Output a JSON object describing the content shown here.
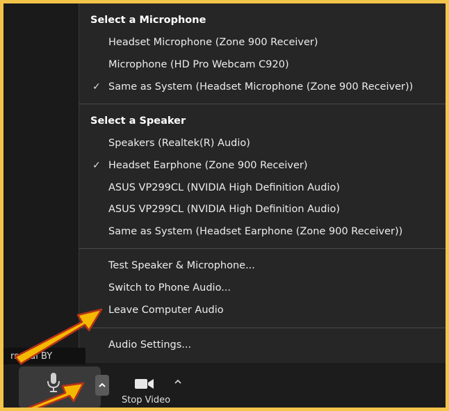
{
  "menu": {
    "microphone_section": {
      "title": "Select a Microphone",
      "items": [
        {
          "label": "Headset Microphone (Zone 900 Receiver)",
          "checked": false
        },
        {
          "label": "Microphone (HD Pro Webcam C920)",
          "checked": false
        },
        {
          "label": "Same as System (Headset Microphone (Zone 900 Receiver))",
          "checked": true
        }
      ]
    },
    "speaker_section": {
      "title": "Select a Speaker",
      "items": [
        {
          "label": "Speakers (Realtek(R) Audio)",
          "checked": false
        },
        {
          "label": "Headset Earphone (Zone 900 Receiver)",
          "checked": true
        },
        {
          "label": "ASUS VP299CL (NVIDIA High Definition Audio)",
          "checked": false
        },
        {
          "label": "ASUS VP299CL (NVIDIA High Definition Audio)",
          "checked": false
        },
        {
          "label": "Same as System (Headset Earphone (Zone 900 Receiver))",
          "checked": false
        }
      ]
    },
    "actions": [
      {
        "label": "Test Speaker & Microphone..."
      },
      {
        "label": "Switch to Phone Audio..."
      },
      {
        "label": "Leave Computer Audio"
      }
    ],
    "settings_label": "Audio Settings...",
    "check_glyph": "✓"
  },
  "participant_name": "rsonal BY",
  "toolbar": {
    "stop_video_label": "Stop Video",
    "mic_icon": "microphone-icon",
    "video_icon": "video-camera-icon"
  },
  "colors": {
    "frame": "#f3c44a",
    "arrow_fill": "#f5b800",
    "arrow_stroke": "#b8321a",
    "menu_bg": "#262626"
  }
}
